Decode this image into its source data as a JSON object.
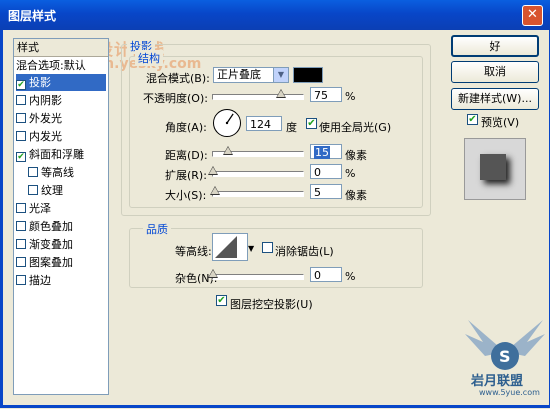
{
  "window": {
    "title": "图层样式"
  },
  "watermark": {
    "line1": "天极设计在线",
    "line2": "sign.yesky.com",
    "brand": "岩月联盟",
    "brand_url": "www.5yue.com"
  },
  "left_panel": {
    "header": "样式",
    "items": [
      {
        "label": "混合选项:默认",
        "checkbox": false
      },
      {
        "label": "投影",
        "checkbox": true,
        "checked": true,
        "selected": true
      },
      {
        "label": "内阴影",
        "checkbox": true,
        "checked": false
      },
      {
        "label": "外发光",
        "checkbox": true,
        "checked": false
      },
      {
        "label": "内发光",
        "checkbox": true,
        "checked": false
      },
      {
        "label": "斜面和浮雕",
        "checkbox": true,
        "checked": true
      },
      {
        "label": "等高线",
        "checkbox": true,
        "checked": false,
        "indent": true
      },
      {
        "label": "纹理",
        "checkbox": true,
        "checked": false,
        "indent": true
      },
      {
        "label": "光泽",
        "checkbox": true,
        "checked": false
      },
      {
        "label": "颜色叠加",
        "checkbox": true,
        "checked": false
      },
      {
        "label": "渐变叠加",
        "checkbox": true,
        "checked": false
      },
      {
        "label": "图案叠加",
        "checkbox": true,
        "checked": false
      },
      {
        "label": "描边",
        "checkbox": true,
        "checked": false
      }
    ]
  },
  "shadow": {
    "section_title": "投影",
    "structure_title": "结构",
    "blend_mode_label": "混合模式(B):",
    "blend_mode_value": "正片叠底",
    "opacity_label": "不透明度(O):",
    "opacity_value": "75",
    "opacity_unit": "%",
    "opacity_fraction": 0.75,
    "angle_label": "角度(A):",
    "angle_value": "124",
    "angle_unit": "度",
    "global_light_label": "使用全局光(G)",
    "global_light_checked": true,
    "distance_label": "距离(D):",
    "distance_value": "15",
    "distance_unit": "像素",
    "spread_label": "扩展(R):",
    "spread_value": "0",
    "spread_unit": "%",
    "size_label": "大小(S):",
    "size_value": "5",
    "size_unit": "像素",
    "quality_title": "品质",
    "contour_label": "等高线:",
    "antialias_label": "消除锯齿(L)",
    "antialias_checked": false,
    "noise_label": "杂色(N):",
    "noise_value": "0",
    "noise_unit": "%",
    "knockout_label": "图层挖空投影(U)",
    "knockout_checked": true,
    "shadow_color": "#000000"
  },
  "buttons": {
    "ok": "好",
    "cancel": "取消",
    "new_style": "新建样式(W)...",
    "preview_label": "预览(V)",
    "preview_checked": true
  }
}
